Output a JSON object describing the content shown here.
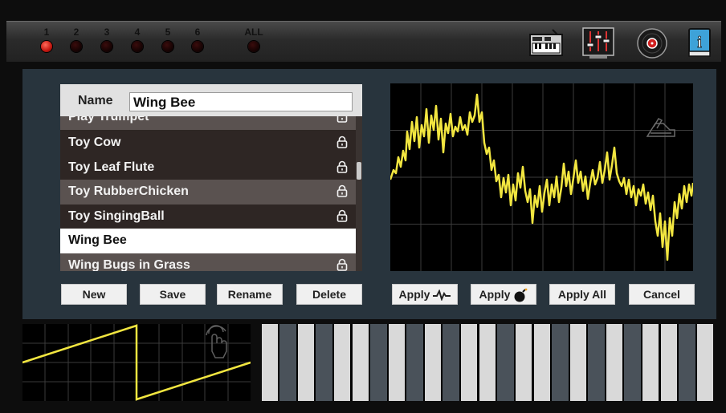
{
  "channels": {
    "items": [
      {
        "label": "1",
        "active": true
      },
      {
        "label": "2",
        "active": false
      },
      {
        "label": "3",
        "active": false
      },
      {
        "label": "4",
        "active": false
      },
      {
        "label": "5",
        "active": false
      },
      {
        "label": "6",
        "active": false
      },
      {
        "label": "ALL",
        "active": false
      }
    ]
  },
  "toolbar": {
    "icons": [
      "keyboard-icon",
      "mixer-icon",
      "vinyl-record-icon",
      "info-book-icon"
    ]
  },
  "preset": {
    "name_label": "Name",
    "name_value": "Wing Bee",
    "items": [
      {
        "label": "Play Trumpet",
        "locked": true
      },
      {
        "label": "Toy Cow",
        "locked": true
      },
      {
        "label": "Toy Leaf Flute",
        "locked": true
      },
      {
        "label": "Toy RubberChicken",
        "locked": true
      },
      {
        "label": "Toy SingingBall",
        "locked": true
      },
      {
        "label": "Wing Bee",
        "locked": false,
        "selected": true
      },
      {
        "label": "Wing Bugs in Grass",
        "locked": true
      }
    ]
  },
  "buttons": {
    "new": "New",
    "save": "Save",
    "rename": "Rename",
    "delete": "Delete",
    "apply_wave": "Apply",
    "apply_bomb": "Apply",
    "apply_all": "Apply All",
    "cancel": "Cancel"
  },
  "colors": {
    "led_on": "#e0231a",
    "waveform": "#f2e640",
    "panel": "#28343d",
    "selected_row": "#ffffff"
  }
}
